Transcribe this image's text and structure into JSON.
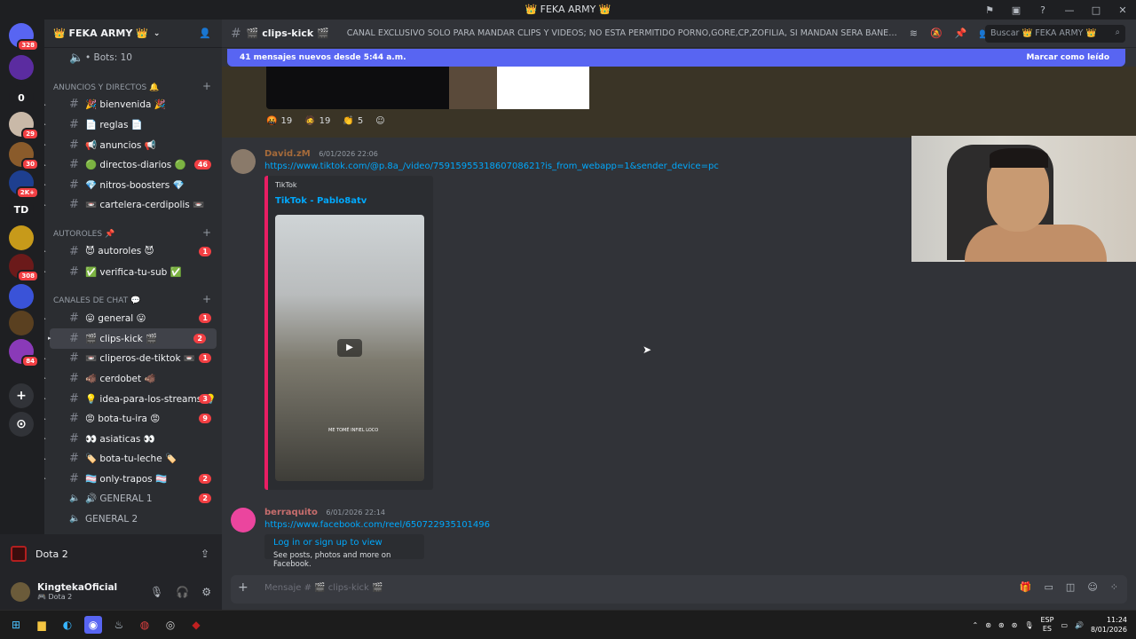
{
  "window": {
    "title": "👑 FEKA ARMY 👑"
  },
  "titlebar_icons": [
    "inbox-icon",
    "screen-share-icon",
    "help-icon",
    "minimize-icon",
    "maximize-icon",
    "close-icon"
  ],
  "servers": [
    {
      "label": "",
      "badge": "328",
      "color": "#5865f2"
    },
    {
      "label": "",
      "badge": "",
      "color": "#5b2ca0"
    },
    {
      "label": "0",
      "badge": "",
      "color": "#1e1f22"
    },
    {
      "label": "",
      "badge": "29",
      "color": "#c9b9a8"
    },
    {
      "label": "",
      "badge": "30",
      "color": "#8a5b2b"
    },
    {
      "label": "",
      "badge": "2K+",
      "color": "#1e3f8f"
    },
    {
      "label": "TD",
      "badge": "",
      "color": "#1e1f22"
    },
    {
      "label": "",
      "badge": "",
      "color": "#c79a1a"
    },
    {
      "label": "",
      "badge": "308",
      "color": "#6b1a1a"
    },
    {
      "label": "",
      "badge": "",
      "color": "#3a53d8"
    },
    {
      "label": "",
      "badge": "",
      "color": "#5a4020"
    },
    {
      "label": "",
      "badge": "84",
      "color": "#8a3ab8"
    }
  ],
  "guild": {
    "name": "👑 FEKA ARMY 👑"
  },
  "channels": {
    "bots": "• Bots: 10",
    "cat1": "ANUNCIOS Y DIRECTOS 🔔",
    "cat2": "AUTOROLES 📌",
    "cat3": "CANALES DE CHAT 💬",
    "list1": [
      {
        "name": "🎉 bienvenida 🎉",
        "count": "",
        "active": false,
        "unread": true
      },
      {
        "name": "📄 reglas 📄",
        "count": "",
        "active": false,
        "unread": true
      },
      {
        "name": "📢 anuncios 📢",
        "count": "",
        "active": false,
        "unread": true
      },
      {
        "name": "🟢 directos-diarios 🟢",
        "count": "46",
        "active": false,
        "unread": true
      },
      {
        "name": "💎 nitros-boosters 💎",
        "count": "",
        "active": false,
        "unread": true
      },
      {
        "name": "📼 cartelera-cerdipolis 📼",
        "count": "",
        "active": false,
        "unread": true
      }
    ],
    "list2": [
      {
        "name": "😈 autoroles 😈",
        "count": "1",
        "active": false,
        "unread": true
      },
      {
        "name": "✅ verifica-tu-sub ✅",
        "count": "",
        "active": false,
        "unread": true
      }
    ],
    "list3": [
      {
        "name": "😛 general 😛",
        "count": "1",
        "active": false,
        "unread": true
      },
      {
        "name": "🎬 clips-kick 🎬",
        "count": "2",
        "active": true,
        "unread": true
      },
      {
        "name": "📼 cliperos-de-tiktok 📼",
        "count": "1",
        "active": false,
        "unread": true
      },
      {
        "name": "🐗 cerdobet 🐗",
        "count": "",
        "active": false,
        "unread": true
      },
      {
        "name": "💡 idea-para-los-streams 💡",
        "count": "3",
        "active": false,
        "unread": true
      },
      {
        "name": "😡 bota-tu-ira 😡",
        "count": "9",
        "active": false,
        "unread": true
      },
      {
        "name": "👀 asiaticas 👀",
        "count": "",
        "active": false,
        "unread": true
      },
      {
        "name": "🏷️ bota-tu-leche 🏷️",
        "count": "",
        "active": false,
        "unread": true
      },
      {
        "name": "🏳️‍⚧️ only-trapos 🏳️‍⚧️",
        "count": "2",
        "active": false,
        "unread": true
      }
    ],
    "voice": [
      {
        "name": "🔊 GENERAL 1",
        "count": "2"
      },
      {
        "name": "GENERAL 2",
        "count": ""
      },
      {
        "name": "GENERAL 3",
        "count": ""
      }
    ]
  },
  "voice_activity": {
    "label": "Dota 2"
  },
  "user": {
    "name": "KingtekaOficial",
    "status": "🎮 Dota 2"
  },
  "channel_header": {
    "name": "🎬 clips-kick 🎬",
    "topic": "CANAL EXCLUSIVO SOLO PARA MANDAR CLIPS Y VIDEOS; NO ESTA PERMITIDO PORNO,GORE,CP,ZOFILIA, SI MANDAN SERA BANEADO PERMA...",
    "search_placeholder": "Buscar 👑 FEKA ARMY 👑"
  },
  "new_messages": {
    "text": "41 mensajes nuevos desde 5:44 a.m.",
    "mark": "Marcar como leído"
  },
  "reactions": [
    {
      "emoji": "🤬",
      "count": "19"
    },
    {
      "emoji": "🧔",
      "count": "19"
    },
    {
      "emoji": "👏",
      "count": "5"
    }
  ],
  "messages": [
    {
      "author": "David.zM",
      "timestamp": "6/01/2026 22:06",
      "link": "https://www.tiktok.com/@p.8a_/video/7591595531860708621?is_from_webapp=1&sender_device=pc",
      "embed_provider": "TikTok",
      "embed_title": "TikTok - Pablo8atv",
      "video_caption": "ME TOMÉ INFIEL LOCO"
    },
    {
      "author": "berraquito",
      "timestamp": "6/01/2026 22:14",
      "link": "https://www.facebook.com/reel/650722935101496",
      "embed_title": "Log in or sign up to view",
      "embed_desc": "See posts, photos and more on Facebook."
    }
  ],
  "composer": {
    "placeholder": "Mensaje # 🎬 clips-kick 🎬"
  },
  "taskbar": {
    "lang": "ESP",
    "lang2": "ES",
    "time": "11:24",
    "date": "8/01/2026"
  }
}
